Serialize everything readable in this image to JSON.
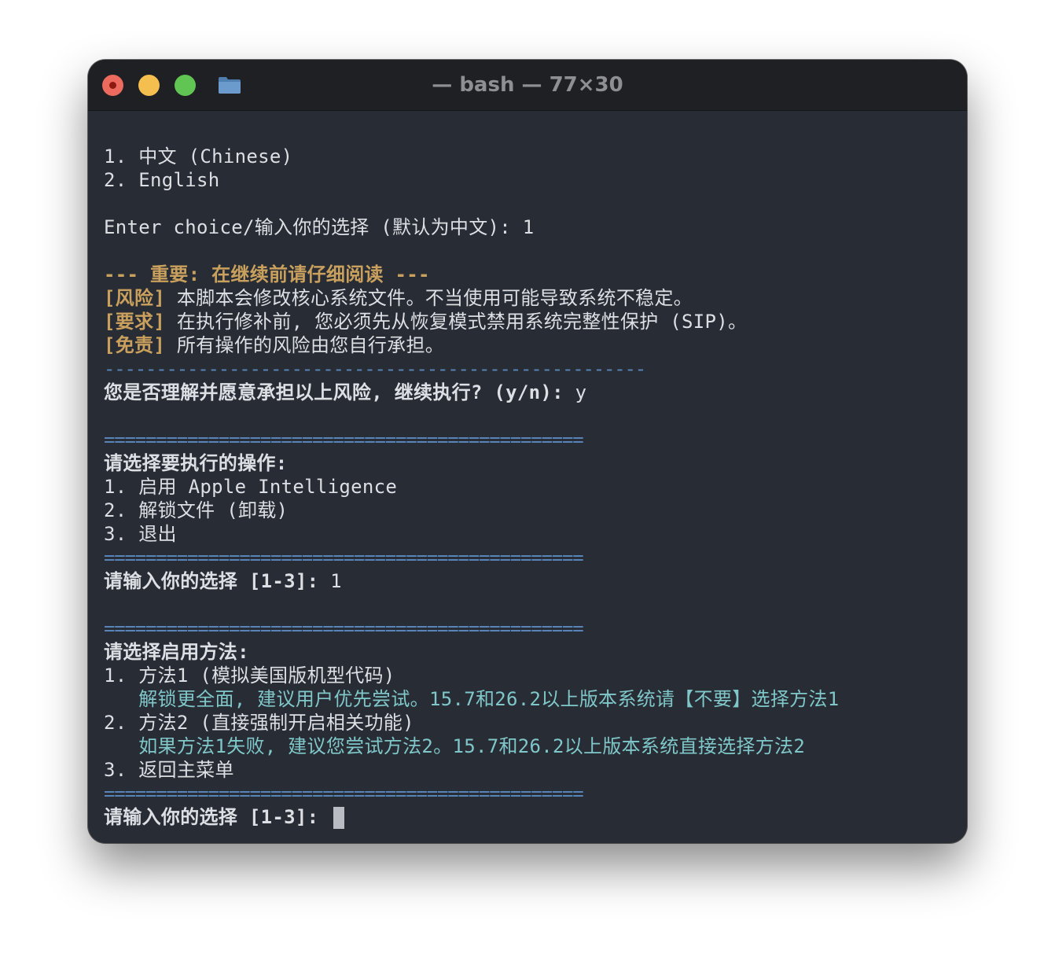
{
  "window": {
    "title": "— bash — 77×30"
  },
  "terminal": {
    "lang_opt1": "1. 中文 (Chinese)",
    "lang_opt2": "2. English",
    "enter_choice_prompt": "Enter choice/输入你的选择 (默认为中文): ",
    "enter_choice_value": "1",
    "important_header": "--- 重要: 在继续前请仔细阅读 ---",
    "risk_tag": "[风险]",
    "risk_text": " 本脚本会修改核心系统文件。不当使用可能导致系统不稳定。",
    "req_tag": "[要求]",
    "req_text": " 在执行修补前, 您必须先从恢复模式禁用系统完整性保护 (SIP)。",
    "disclaimer_tag": "[免责]",
    "disclaimer_text": " 所有操作的风险由您自行承担。",
    "dash_sep": "----------------------------------------------------",
    "confirm_prompt": "您是否理解并愿意承担以上风险, 继续执行? (y/n): ",
    "confirm_value": "y",
    "eq_sep": "==============================================",
    "menu_title": "请选择要执行的操作:",
    "menu_opt1": "1. 启用 Apple Intelligence",
    "menu_opt2": "2. 解锁文件 (卸载)",
    "menu_opt3": "3. 退出",
    "menu_prompt": "请输入你的选择 [1-3]: ",
    "menu_value": "1",
    "method_title": "请选择启用方法:",
    "method_opt1": "1. 方法1 (模拟美国版机型代码)",
    "method_opt1_hint": "   解锁更全面, 建议用户优先尝试。15.7和26.2以上版本系统请【不要】选择方法1",
    "method_opt2": "2. 方法2 (直接强制开启相关功能)",
    "method_opt2_hint": "   如果方法1失败, 建议您尝试方法2。15.7和26.2以上版本系统直接选择方法2",
    "method_opt3": "3. 返回主菜单",
    "final_prompt": "请输入你的选择 [1-3]: "
  },
  "colors": {
    "background": "#282c34",
    "warning": "#c9a05d",
    "hint": "#7fc7c9",
    "separator": "#5884b8"
  }
}
